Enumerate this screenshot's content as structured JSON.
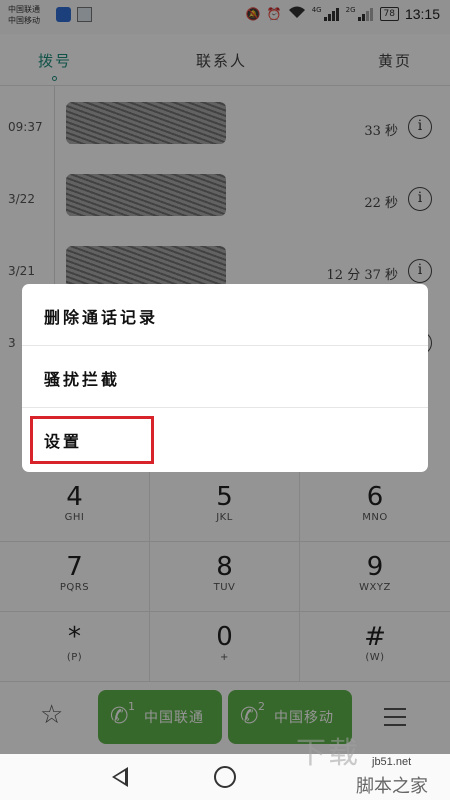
{
  "status_bar": {
    "carrier1": "中国联通",
    "carrier2": "中国移动",
    "net1": "4G",
    "net2": "2G",
    "battery": "78",
    "time": "13:15",
    "icons": [
      "mute-icon",
      "alarm-icon",
      "wifi-icon",
      "signal-icon",
      "battery-icon"
    ]
  },
  "tabs": [
    {
      "label": "拨号",
      "active": true
    },
    {
      "label": "联系人",
      "active": false
    },
    {
      "label": "黄页",
      "active": false
    }
  ],
  "calls": [
    {
      "time": "09:37",
      "duration": "33 秒"
    },
    {
      "time": "3/22",
      "duration": "22 秒"
    },
    {
      "time": "3/21",
      "duration": "12 分 37 秒"
    },
    {
      "time": "3",
      "duration": ""
    }
  ],
  "menu": {
    "items": [
      "删除通话记录",
      "骚扰拦截",
      "设置"
    ],
    "highlighted": "设置",
    "highlight_color": "#d9232a"
  },
  "keypad": [
    {
      "digit": "4",
      "letters": "GHI"
    },
    {
      "digit": "5",
      "letters": "JKL"
    },
    {
      "digit": "6",
      "letters": "MNO"
    },
    {
      "digit": "7",
      "letters": "PQRS"
    },
    {
      "digit": "8",
      "letters": "TUV"
    },
    {
      "digit": "9",
      "letters": "WXYZ"
    },
    {
      "digit": "*",
      "letters": "(P)"
    },
    {
      "digit": "0",
      "letters": "+"
    },
    {
      "digit": "#",
      "letters": "(W)"
    }
  ],
  "action_bar": {
    "call1_sim": "1",
    "call1_label": "中国联通",
    "call2_sim": "2",
    "call2_label": "中国移动",
    "call_color": "#5fb44a"
  },
  "watermark": {
    "big": "下载",
    "url": "jb51.net",
    "site": "脚本之家"
  }
}
